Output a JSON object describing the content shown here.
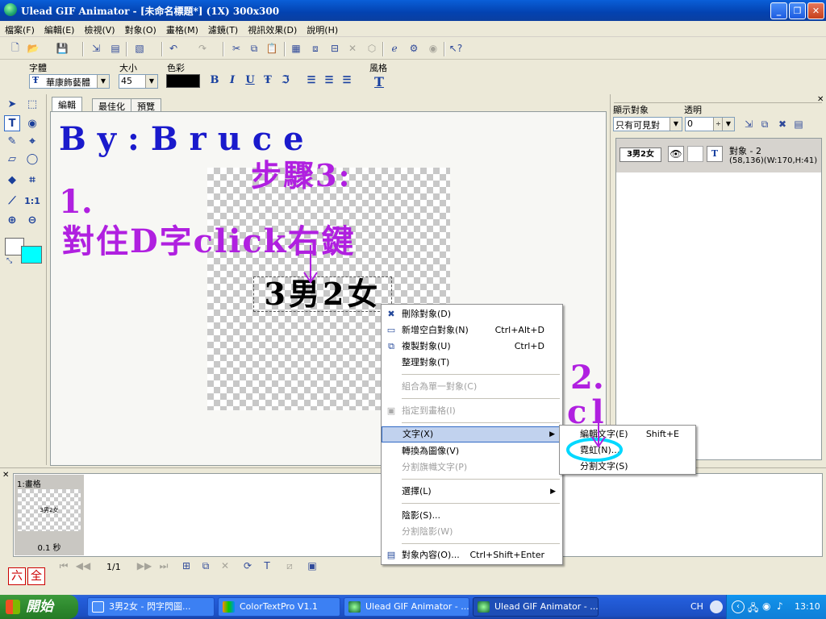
{
  "window": {
    "title": "Ulead GIF Animator - [未命名標題*] (1X) 300x300",
    "min_label": "_",
    "max_label": "❐",
    "close_label": "✕"
  },
  "menu": [
    "檔案(F)",
    "編輯(E)",
    "檢視(V)",
    "對象(O)",
    "畫格(M)",
    "濾鏡(T)",
    "視訊效果(D)",
    "說明(H)"
  ],
  "textbar": {
    "font_label": "字體",
    "font_value": "華康飾藝體",
    "size_label": "大小",
    "size_value": "45",
    "color_label": "色彩",
    "color_value": "#000000",
    "style_label": "風格",
    "bold": "B",
    "italic": "I",
    "underline": "U",
    "strike": "Ŧ",
    "outline": "ℑ",
    "style_icon": "T"
  },
  "tabs": [
    "編輯",
    "最佳化",
    "預覽"
  ],
  "canvas": {
    "text": "3男2女"
  },
  "annotations": {
    "author": "By:Bruce",
    "step": "步驟3:",
    "step1_num": "1.",
    "step1_text": "對住D字click右鍵",
    "step2_num": "2.",
    "step2_text": "click依個",
    "color_blue": "#1a1acc",
    "color_purple": "#b020e0"
  },
  "toolbox": {
    "zoom_label": "1:1",
    "fg_color": "#ffffff",
    "bg_color": "#00ffff"
  },
  "rightpanel": {
    "show_label": "顯示對象",
    "alpha_label": "透明",
    "show_value": "只有可見對",
    "alpha_value": "0",
    "object": {
      "thumb": "3男2女",
      "name": "對象 - 2",
      "info": "(58,136)(W:170,H:41)"
    }
  },
  "frames": {
    "frame1_label": "1:畫格",
    "frame1_thumb": "3男2女",
    "frame1_delay": "0.1 秒",
    "counter": "1/1"
  },
  "context_menu": {
    "items": [
      {
        "label": "刪除對象(D)",
        "shortcut": "",
        "icon": "✖",
        "disabled": false
      },
      {
        "label": "新增空白對象(N)",
        "shortcut": "Ctrl+Alt+D",
        "icon": "",
        "disabled": false
      },
      {
        "label": "複製對象(U)",
        "shortcut": "Ctrl+D",
        "icon": "⧉",
        "disabled": false
      },
      {
        "label": "整理對象(T)",
        "shortcut": "",
        "icon": "",
        "disabled": false
      },
      {
        "label": "組合為單一對象(C)",
        "shortcut": "",
        "icon": "",
        "disabled": true
      },
      {
        "label": "指定到畫格(I)",
        "shortcut": "",
        "icon": "▣",
        "disabled": true
      },
      {
        "label": "文字(X)",
        "shortcut": "",
        "icon": "",
        "disabled": false,
        "submenu": true
      },
      {
        "label": "轉換為圖像(V)",
        "shortcut": "",
        "icon": "",
        "disabled": false
      },
      {
        "label": "分割旗幟文字(P)",
        "shortcut": "",
        "icon": "",
        "disabled": true
      },
      {
        "label": "選擇(L)",
        "shortcut": "",
        "icon": "",
        "disabled": false,
        "submenu": true
      },
      {
        "label": "陰影(S)...",
        "shortcut": "",
        "icon": "",
        "disabled": false
      },
      {
        "label": "分割陰影(W)",
        "shortcut": "",
        "icon": "",
        "disabled": true
      },
      {
        "label": "對象內容(O)...",
        "shortcut": "Ctrl+Shift+Enter",
        "icon": "▤",
        "disabled": false
      }
    ],
    "submenu_arrow": "▶"
  },
  "submenu": {
    "items": [
      {
        "label": "編輯文字(E)",
        "shortcut": "Shift+E"
      },
      {
        "label": "霓虹(N)...",
        "shortcut": ""
      },
      {
        "label": "分割文字(S)",
        "shortcut": ""
      }
    ]
  },
  "corner_buttons": [
    "六",
    "全"
  ],
  "taskbar": {
    "start": "開始",
    "buttons": [
      "3男2女 - 閃字閃圖...",
      "ColorTextPro V1.1",
      "Ulead GIF Animator - ...",
      "Ulead GIF Animator - ..."
    ],
    "lang": "CH",
    "clock": "13:10"
  }
}
